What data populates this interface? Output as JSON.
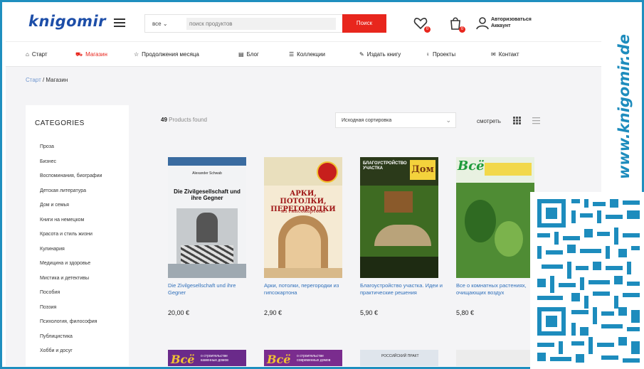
{
  "header": {
    "logo": "knigomir",
    "search_category": "все",
    "search_placeholder": "поиск продуктов",
    "search_button": "Поиск",
    "wishlist_count": "0",
    "cart_count": "0",
    "account_line1": "Авторизоваться",
    "account_line2": "Аккаунт"
  },
  "nav": {
    "items": [
      {
        "label": "Старт",
        "icon": "home-icon"
      },
      {
        "label": "Магазин",
        "icon": "cart-icon"
      },
      {
        "label": "Продолжения месяца",
        "icon": "star-icon"
      },
      {
        "label": "Блог",
        "icon": "book-icon"
      },
      {
        "label": "Коллекции",
        "icon": "collection-icon"
      },
      {
        "label": "Издать книгу",
        "icon": "publish-icon"
      },
      {
        "label": "Проекты",
        "icon": "lightbulb-icon"
      },
      {
        "label": "Контакт",
        "icon": "mail-icon"
      }
    ]
  },
  "breadcrumb": {
    "home": "Старт",
    "separator": " / ",
    "current": "Магазин"
  },
  "sidebar": {
    "title": "CATEGORIES",
    "items": [
      "Проза",
      "Бизнес",
      "Воспоминания, биографии",
      "Детская литература",
      "Дом и семья",
      "Книги на немецком",
      "Красота и стиль жизни",
      "Кулинария",
      "Медицина и здоровье",
      "Мистика и детективы",
      "Пособия",
      "Поэзия",
      "Психология, философия",
      "Публицистика",
      "Хобби и досуг"
    ]
  },
  "toolbar": {
    "count_number": "49",
    "count_text": " Products found",
    "sort_label": "Исходная сортировка",
    "view_label": "смотреть"
  },
  "products": [
    {
      "title": "Die Zivilgesellschaft und ihre Gegner",
      "price": "20,00 €",
      "cover_author": "Alexander Schwab",
      "cover_title": "Die Zivilgesellschaft und ihre Gegner"
    },
    {
      "title": "Арки, потолки, перегородки из гипсокартона",
      "price": "2,90 €",
      "cover_title": "АРКИ, ПОТОЛКИ, ПЕРЕГОРОДКИ",
      "cover_subtitle": "из гипсокартона"
    },
    {
      "title": "Благоустройство участка. Идеи и практические решения",
      "price": "5,90 €",
      "cover_title": "БЛАГОУСТРОЙСТВО УЧАСТКА",
      "cover_brand": "Дом"
    },
    {
      "title": "Все о комнатных растениях, очищающих воздух",
      "price": "5,80 €",
      "cover_brand": "Всё"
    }
  ],
  "row2_covers": [
    {
      "brand": "Всё",
      "text": "о строительстве каменных домов"
    },
    {
      "brand": "Всё",
      "text": "о строительстве современных домов"
    },
    {
      "brand": "",
      "text": "РОССИЙСКИЙ ПРАКТ"
    }
  ],
  "side_brand": "www.knigomir.de",
  "colors": {
    "brand_blue": "#1d4ea8",
    "accent_red": "#e8261d",
    "side_blue": "#1d8cbd",
    "link_blue": "#2f6fba"
  }
}
